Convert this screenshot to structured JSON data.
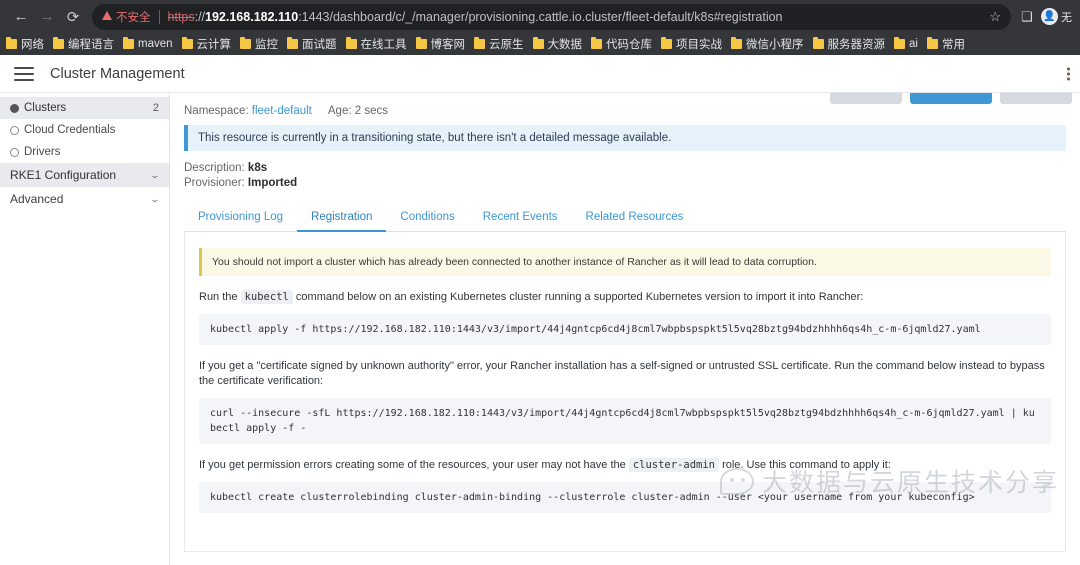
{
  "browser": {
    "back_icon": "←",
    "forward_icon": "→",
    "reload_icon": "⟳",
    "security_label": "不安全",
    "url": {
      "scheme": "https",
      "separator": "://",
      "host": "192.168.182.110",
      "rest": ":1443/dashboard/c/_/manager/provisioning.cattle.io.cluster/fleet-default/k8s#registration"
    },
    "bookmark_star": "☆",
    "toolbar_icons": [
      "side-panel-icon"
    ],
    "incognito_label": "无",
    "bookmarks": [
      "网络",
      "编程语言",
      "maven",
      "云计算",
      "监控",
      "面试题",
      "在线工具",
      "博客网",
      "云原生",
      "大数据",
      "代码仓库",
      "项目实战",
      "微信小程序",
      "服务器资源",
      "ai",
      "常用"
    ]
  },
  "app": {
    "title": "Cluster Management",
    "sidebar": [
      {
        "label": "Clusters",
        "count": "2",
        "icon": "globe-filled-icon",
        "state": "active",
        "type": "item"
      },
      {
        "label": "Cloud Credentials",
        "count": "",
        "icon": "globe-icon",
        "state": "",
        "type": "item"
      },
      {
        "label": "Drivers",
        "count": "",
        "icon": "globe-icon",
        "state": "",
        "type": "item"
      },
      {
        "label": "RKE1 Configuration",
        "count": "",
        "icon": "chevron-down-icon",
        "state": "",
        "type": "group"
      },
      {
        "label": "Advanced",
        "count": "",
        "icon": "chevron-down-icon",
        "state": "",
        "type": "plain"
      }
    ],
    "top_actions": [
      {
        "label": "",
        "style": "secondary"
      },
      {
        "label": "",
        "style": "primary"
      },
      {
        "label": "",
        "style": "secondary"
      }
    ],
    "meta": {
      "namespace_label": "Namespace:",
      "namespace_value": "fleet-default",
      "age_label": "Age:",
      "age_value": "2 secs"
    },
    "transition_banner": "This resource is currently in a transitioning state, but there isn't a detailed message available.",
    "description_label": "Description:",
    "description_value": "k8s",
    "provisioner_label": "Provisioner:",
    "provisioner_value": "Imported",
    "tabs": [
      {
        "label": "Provisioning Log",
        "active": false
      },
      {
        "label": "Registration",
        "active": true
      },
      {
        "label": "Conditions",
        "active": false
      },
      {
        "label": "Recent Events",
        "active": false
      },
      {
        "label": "Related Resources",
        "active": false
      }
    ],
    "registration": {
      "warning": "You should not import a cluster which has already been connected to another instance of Rancher as it will lead to data corruption.",
      "para1_before": "Run the",
      "para1_code": "kubectl",
      "para1_after": "command below on an existing Kubernetes cluster running a supported Kubernetes version to import it into Rancher:",
      "code1": "kubectl apply -f https://192.168.182.110:1443/v3/import/44j4gntcp6cd4j8cml7wbpbspspkt5l5vq28bztg94bdzhhhh6qs4h_c-m-6jqmld27.yaml",
      "para2": "If you get a \"certificate signed by unknown authority\" error, your Rancher installation has a self-signed or untrusted SSL certificate. Run the command below instead to bypass the certificate verification:",
      "code2": "curl --insecure -sfL https://192.168.182.110:1443/v3/import/44j4gntcp6cd4j8cml7wbpbspspkt5l5vq28bztg94bdzhhhh6qs4h_c-m-6jqmld27.yaml | kubectl apply -f -",
      "para3_before": "If you get permission errors creating some of the resources, your user may not have the",
      "para3_code": "cluster-admin",
      "para3_after": "role. Use this command to apply it:",
      "code3": "kubectl create clusterrolebinding cluster-admin-binding --clusterrole cluster-admin --user <your username from your kubeconfig>"
    }
  },
  "watermark": {
    "text": "大数据与云原生技术分享",
    "logo": "wechat-icon"
  },
  "colors": {
    "accent": "#3d98d3",
    "chrome_bg": "#35363a",
    "warning_bg": "#fbf8e6",
    "info_bg": "#e5f2fa",
    "bookmark_folder": "#f5c544"
  }
}
